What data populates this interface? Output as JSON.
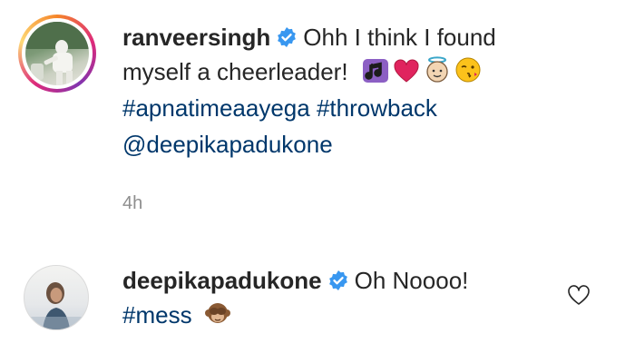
{
  "post": {
    "username": "ranveersingh",
    "caption_line1": "Ohh I think I found",
    "caption_line2": "myself a cheerleader!",
    "hashtags": "#apnatimeaayega #throwback",
    "mention": "@deepikapadukone",
    "time": "4h",
    "emojis": [
      "music-notes-icon",
      "heart-icon",
      "angel-face-icon",
      "kissing-face-icon"
    ]
  },
  "comment": {
    "username": "deepikapadukone",
    "text": "Oh Noooo!",
    "hashtag": "#mess",
    "emoji": "see-no-evil-monkey-icon"
  },
  "colors": {
    "text": "#262626",
    "link": "#00376b",
    "meta": "#8e8e8e",
    "verified": "#3897f0"
  }
}
